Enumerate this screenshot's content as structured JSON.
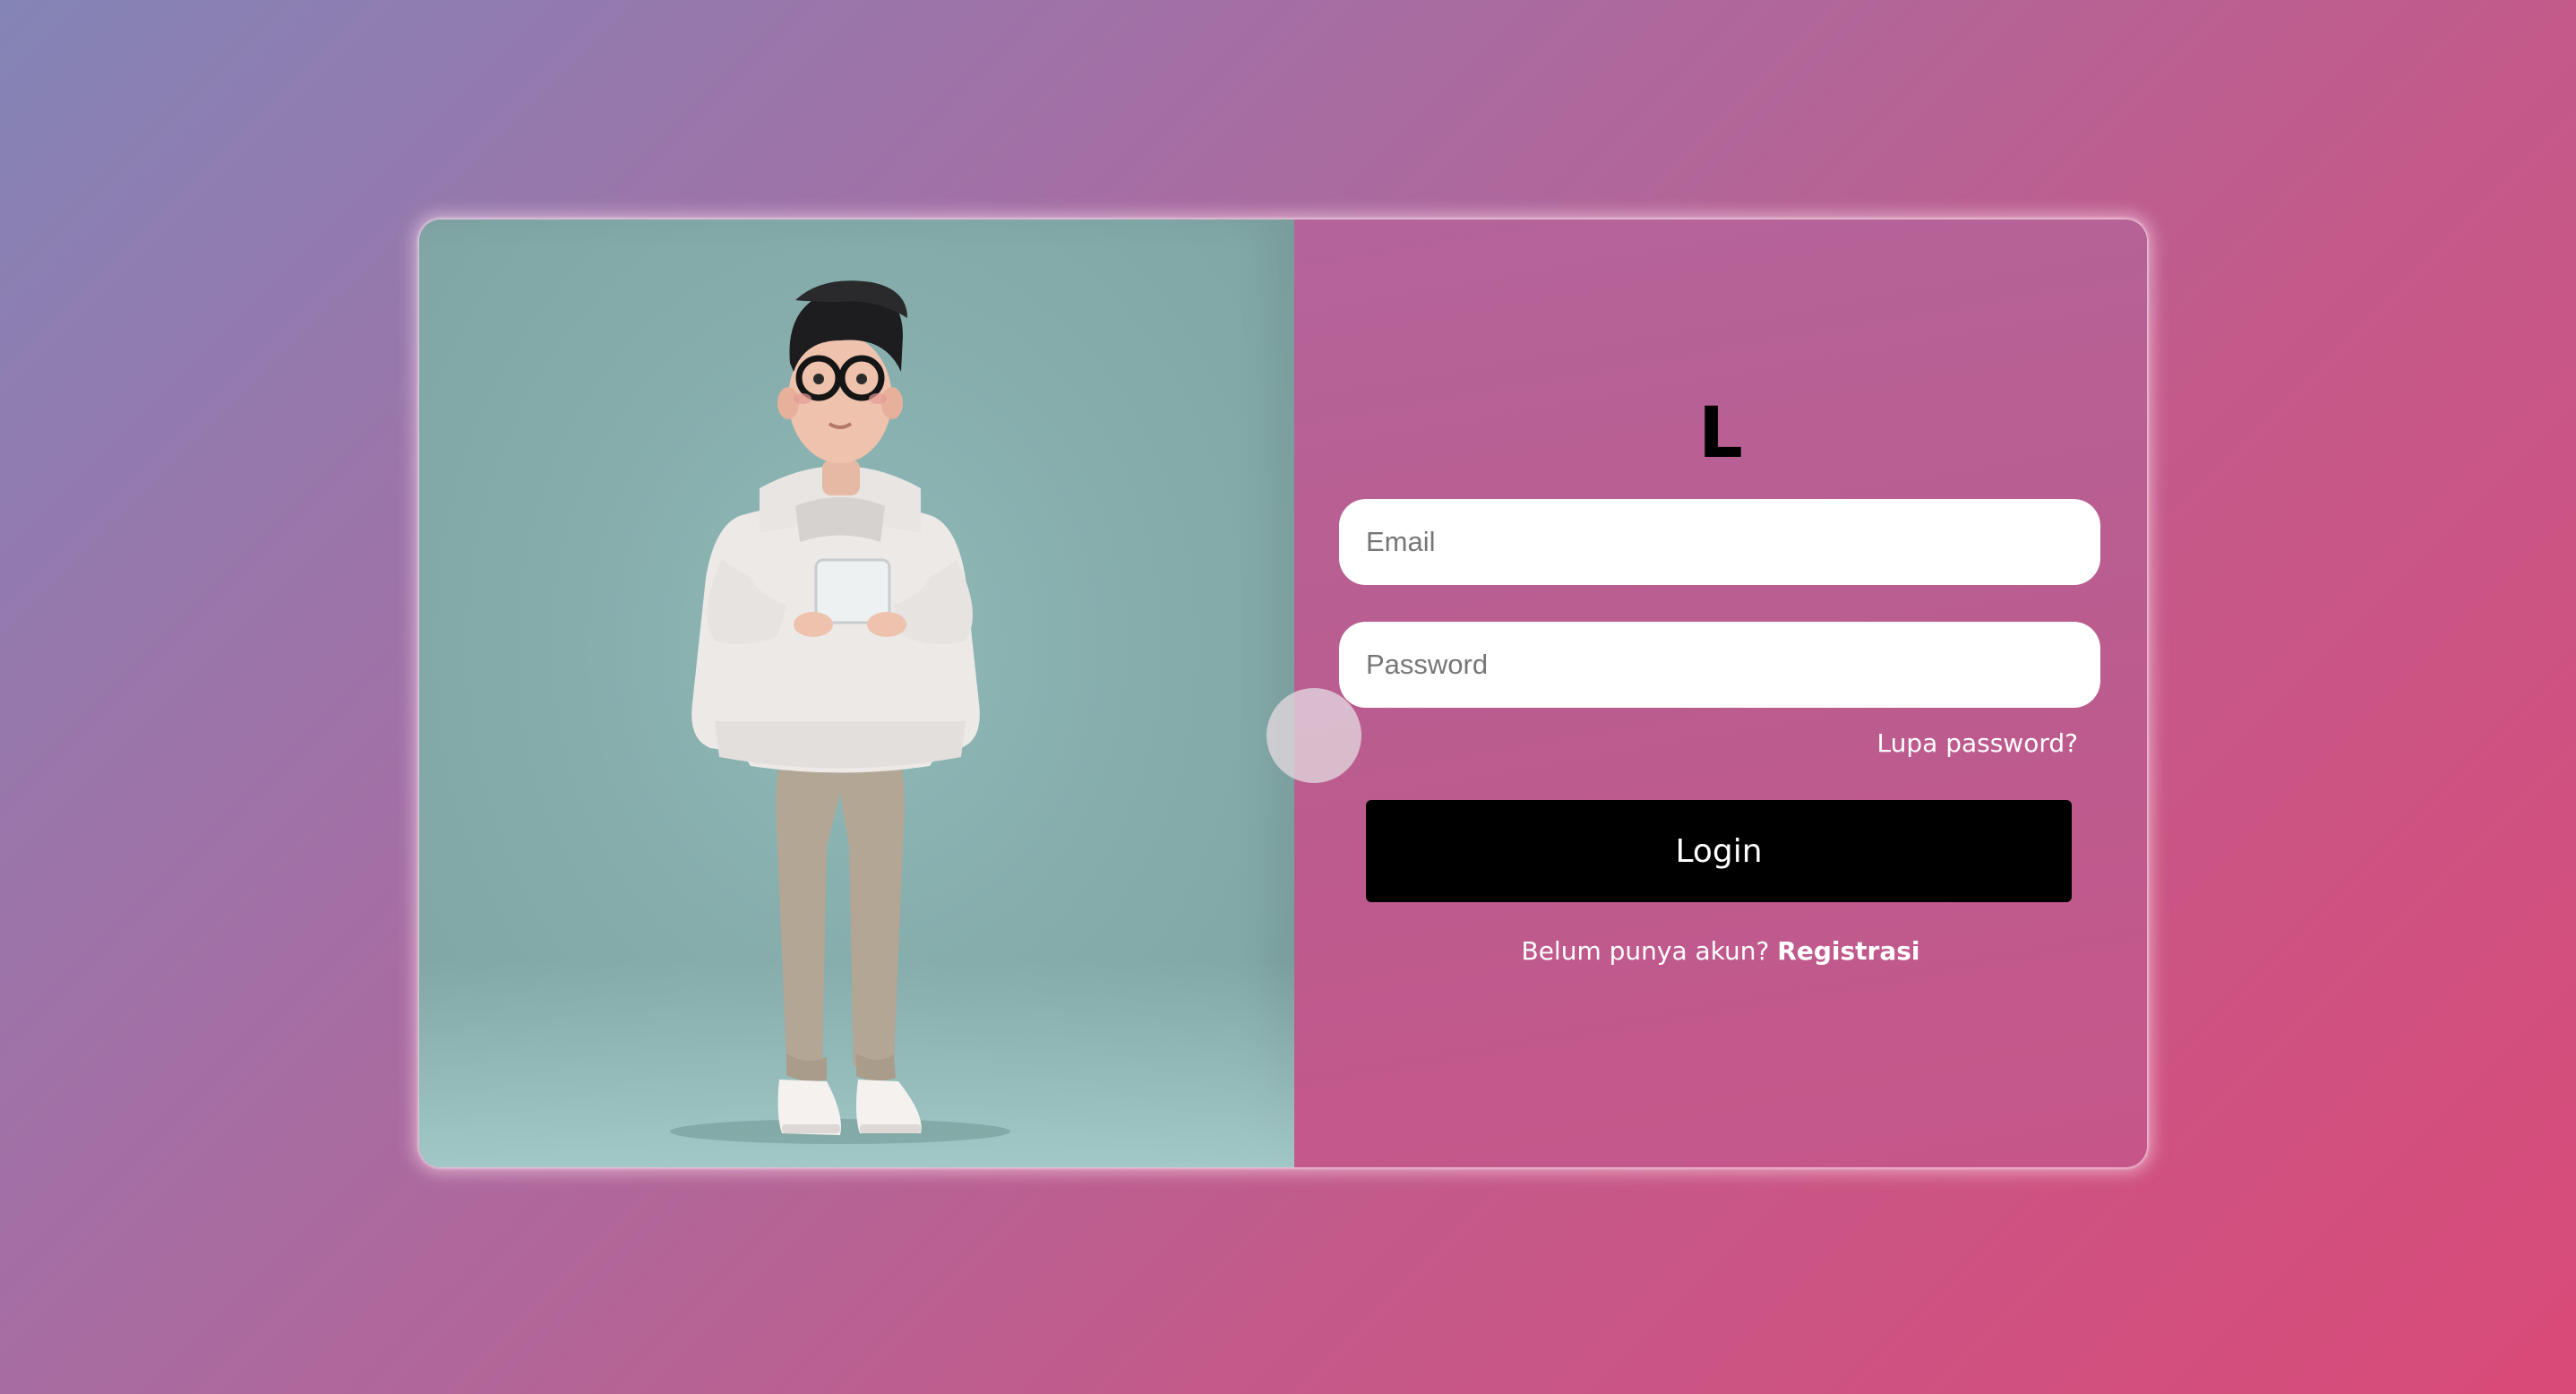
{
  "login": {
    "logo_text": "L",
    "email_placeholder": "Email",
    "password_placeholder": "Password",
    "forgot_password": "Lupa password?",
    "login_button": "Login",
    "register_prompt": "Belum punya akun?",
    "register_link": "Registrasi"
  },
  "colors": {
    "background_start": "#8484b6",
    "background_end": "#d94a78",
    "illustration_bg": "#86adac",
    "button_bg": "#000000",
    "text_on_panel": "#ffffff"
  }
}
